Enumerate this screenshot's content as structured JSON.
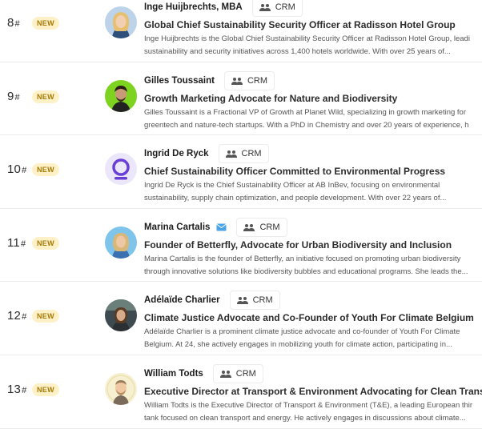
{
  "colors": {
    "badge_bg": "#fff1c7",
    "badge_text": "#a77a06",
    "mail_icon": "#4ba3e8"
  },
  "rows": [
    {
      "rank": "8",
      "badge": "NEW",
      "name": "Inge Huijbrechts, MBA",
      "crm": "CRM",
      "title": "Global Chief Sustainability Security Officer at Radisson Hotel Group",
      "desc1": "Inge Huijbrechts is the Global Chief Sustainability Security Officer at Radisson Hotel Group, leadi",
      "desc2": "sustainability and security initiatives across 1,400 hotels worldwide. With over 25 years of..."
    },
    {
      "rank": "9",
      "badge": "NEW",
      "name": "Gilles Toussaint",
      "crm": "CRM",
      "title": "Growth Marketing Advocate for Nature and Biodiversity",
      "desc1": "Gilles Toussaint is a Fractional VP of Growth at Planet Wild, specializing in growth marketing for",
      "desc2": "greentech and nature-tech startups. With a PhD in Chemistry and over 20 years of experience, h"
    },
    {
      "rank": "10",
      "badge": "NEW",
      "name": "Ingrid De Ryck",
      "crm": "CRM",
      "title": "Chief Sustainability Officer Committed to Environmental Progress",
      "desc1": "Ingrid De Ryck is the Chief Sustainability Officer at AB InBev, focusing on environmental",
      "desc2": "sustainability, supply chain optimization, and people development. With over 22 years of..."
    },
    {
      "rank": "11",
      "badge": "NEW",
      "name": "Marina Cartalis",
      "has_mail": true,
      "crm": "CRM",
      "title": "Founder of Betterfly, Advocate for Urban Biodiversity and Inclusion",
      "desc1": "Marina Cartalis is the founder of Betterfly, an initiative focused on promoting urban biodiversity",
      "desc2": "through innovative solutions like biodiversity bubbles and educational programs. She leads the..."
    },
    {
      "rank": "12",
      "badge": "NEW",
      "name": "Adélaïde Charlier",
      "crm": "CRM",
      "title": "Climate Justice Advocate and Co-Founder of Youth For Climate Belgium",
      "desc1": "Adélaïde Charlier is a prominent climate justice advocate and co-founder of Youth For Climate",
      "desc2": "Belgium. At 24, she actively engages in mobilizing youth for climate action, participating in..."
    },
    {
      "rank": "13",
      "badge": "NEW",
      "name": "William Todts",
      "crm": "CRM",
      "title": "Executive Director at Transport & Environment Advocating for Clean Transport",
      "desc1": "William Todts is the Executive Director of Transport & Environment (T&E), a leading European thir",
      "desc2": "tank focused on clean transport and energy. He actively engages in discussions about climate..."
    }
  ]
}
